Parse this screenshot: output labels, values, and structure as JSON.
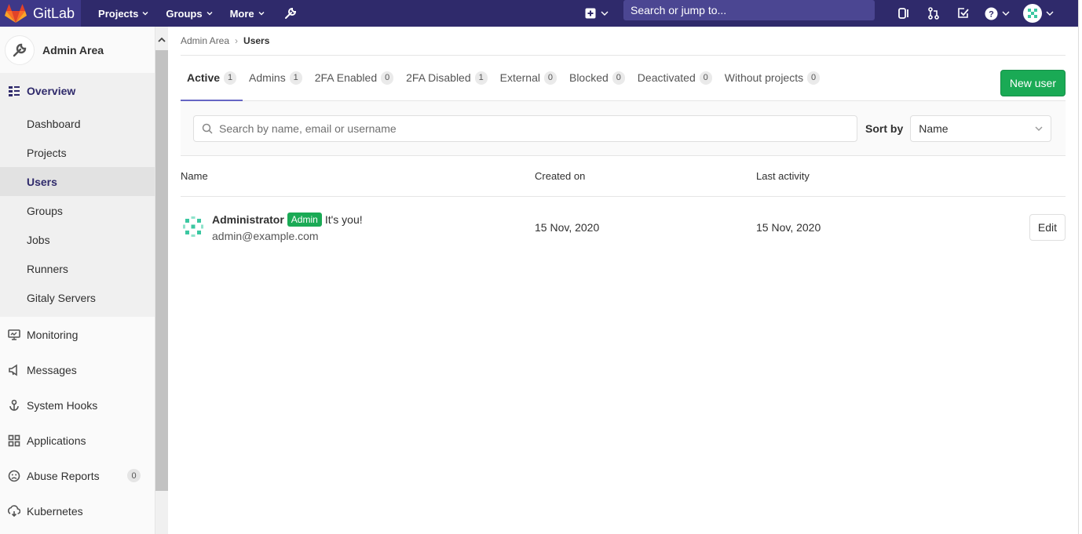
{
  "navbar": {
    "brand": "GitLab",
    "items": [
      {
        "label": "Projects"
      },
      {
        "label": "Groups"
      },
      {
        "label": "More"
      }
    ],
    "search_placeholder": "Search or jump to..."
  },
  "sidebar": {
    "title": "Admin Area",
    "overview_label": "Overview",
    "overview_items": [
      {
        "label": "Dashboard"
      },
      {
        "label": "Projects"
      },
      {
        "label": "Users"
      },
      {
        "label": "Groups"
      },
      {
        "label": "Jobs"
      },
      {
        "label": "Runners"
      },
      {
        "label": "Gitaly Servers"
      }
    ],
    "items": [
      {
        "label": "Monitoring",
        "icon": "monitor-icon"
      },
      {
        "label": "Messages",
        "icon": "messages-icon"
      },
      {
        "label": "System Hooks",
        "icon": "hook-icon"
      },
      {
        "label": "Applications",
        "icon": "applications-icon"
      },
      {
        "label": "Abuse Reports",
        "icon": "abuse-icon",
        "badge": "0"
      },
      {
        "label": "Kubernetes",
        "icon": "kubernetes-icon"
      }
    ]
  },
  "breadcrumb": {
    "parent": "Admin Area",
    "current": "Users"
  },
  "tabs": [
    {
      "label": "Active",
      "count": "1"
    },
    {
      "label": "Admins",
      "count": "1"
    },
    {
      "label": "2FA Enabled",
      "count": "0"
    },
    {
      "label": "2FA Disabled",
      "count": "1"
    },
    {
      "label": "External",
      "count": "0"
    },
    {
      "label": "Blocked",
      "count": "0"
    },
    {
      "label": "Deactivated",
      "count": "0"
    },
    {
      "label": "Without projects",
      "count": "0"
    }
  ],
  "new_user_label": "New user",
  "filter": {
    "search_placeholder": "Search by name, email or username",
    "sort_label": "Sort by",
    "sort_value": "Name"
  },
  "table": {
    "headers": {
      "name": "Name",
      "created": "Created on",
      "activity": "Last activity"
    },
    "rows": [
      {
        "name": "Administrator",
        "badge": "Admin",
        "note": "It's you!",
        "email": "admin@example.com",
        "created": "15 Nov, 2020",
        "activity": "15 Nov, 2020",
        "action": "Edit"
      }
    ]
  },
  "colors": {
    "navbar": "#2f2a6b",
    "accent_green": "#1aaa55",
    "tab_active": "#6666c4"
  }
}
